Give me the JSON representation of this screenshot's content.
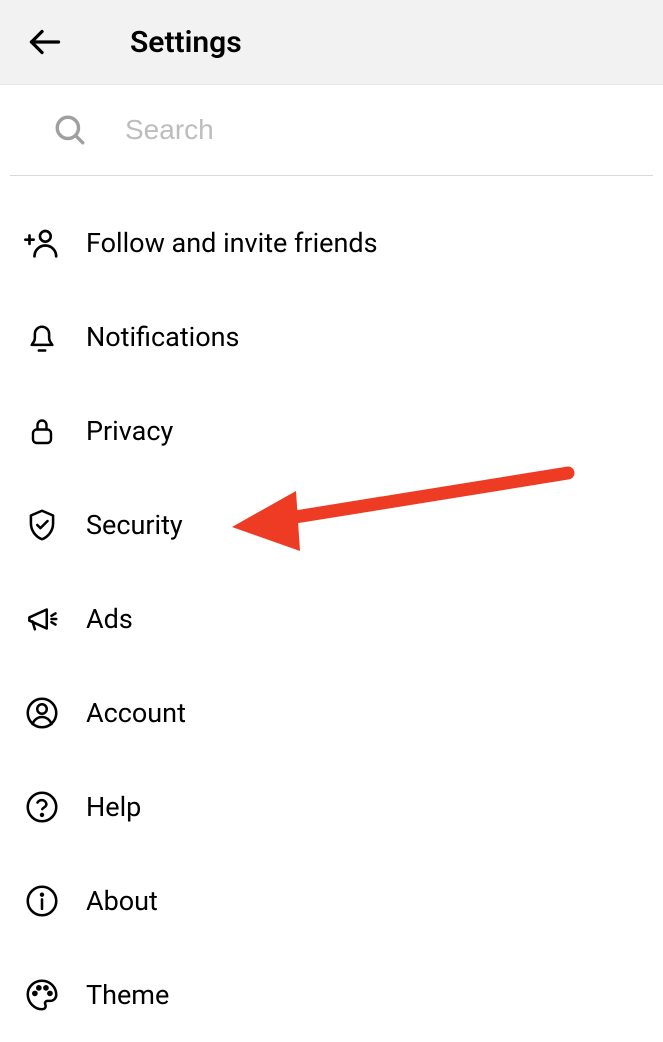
{
  "header": {
    "title": "Settings"
  },
  "search": {
    "placeholder": "Search"
  },
  "menu": {
    "items": [
      {
        "label": "Follow and invite friends"
      },
      {
        "label": "Notifications"
      },
      {
        "label": "Privacy"
      },
      {
        "label": "Security"
      },
      {
        "label": "Ads"
      },
      {
        "label": "Account"
      },
      {
        "label": "Help"
      },
      {
        "label": "About"
      },
      {
        "label": "Theme"
      }
    ]
  }
}
